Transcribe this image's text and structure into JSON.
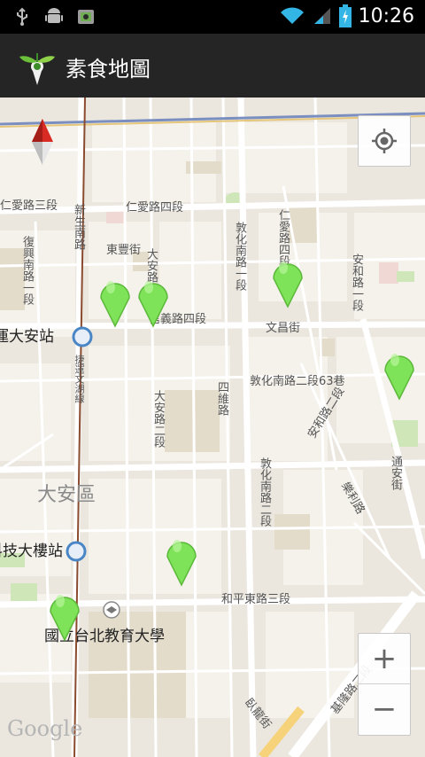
{
  "status_bar": {
    "time": "10:26",
    "icons": [
      "usb-icon",
      "android-debug-icon",
      "sync-icon",
      "wifi-icon",
      "signal-icon",
      "battery-charging-icon"
    ]
  },
  "action_bar": {
    "title": "素食地圖",
    "logo": "sprout-map-pin-logo"
  },
  "map": {
    "district": "大安區",
    "stations": [
      "捷運大安站",
      "捷運科技大樓站"
    ],
    "school": "國立台北教育大學",
    "streets": {
      "renai": "仁愛路三段",
      "renai4": "仁愛路四段",
      "dongfeng": "東豐街",
      "daan_road1": "大安路一段",
      "dunhua_n1": "敦化南路一段",
      "anhe1": "安和路一段",
      "renai4_vertical": "仁愛路四段",
      "xinyi4": "信義路四段",
      "wenchang": "文昌街",
      "dunhua_lane63": "敦化南路二段63巷",
      "siwei": "四維路",
      "daan_road2": "大安路二段",
      "anhe2": "安和路二段",
      "dunhua_n2": "敦化南路二段",
      "leli": "樂利路",
      "tongan": "通安街",
      "heping3": "和平東路三段",
      "wolong": "臥龍街",
      "jilong": "基隆路二段",
      "fuxing": "復興南路一段",
      "xinglong": "新生南路",
      "mrt_line": "捷運文湖線"
    },
    "attribution": "Google",
    "controls": {
      "locate": "my-location-icon",
      "zoom_in": "+",
      "zoom_out": "−",
      "compass": "compass-icon"
    },
    "markers": [
      "marker-1",
      "marker-2",
      "marker-3",
      "marker-4",
      "marker-5",
      "marker-6"
    ]
  },
  "colors": {
    "status_bar": "#000000",
    "action_bar": "#252525",
    "map_bg": "#ebe7df",
    "block": "#f4f1ea",
    "road": "#ffffff",
    "park": "#d0e4b9",
    "marker": "#7fe35a",
    "mrt": "#8a4b2f"
  }
}
